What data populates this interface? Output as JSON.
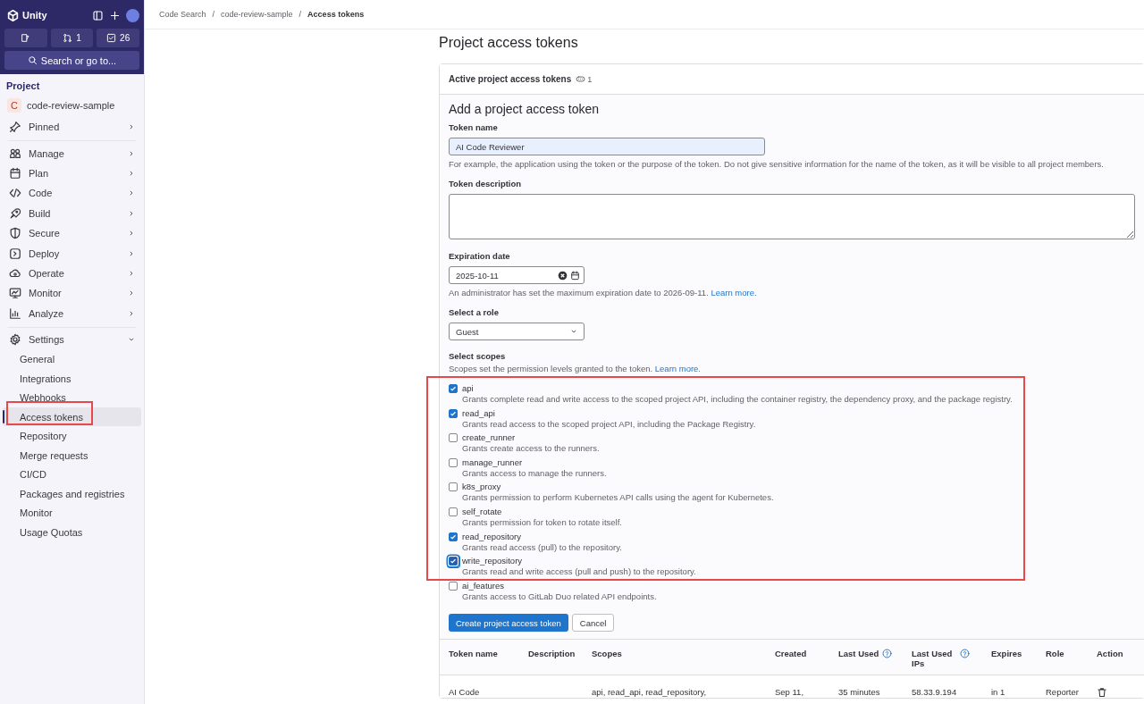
{
  "sidebar": {
    "brand": "Unity",
    "counters": [
      {
        "count": "1"
      },
      {
        "count": "26"
      }
    ],
    "search": "Search or go to...",
    "section": "Project",
    "project": {
      "initial": "C",
      "name": "code-review-sample"
    },
    "groups": [
      [
        {
          "label": "Pinned",
          "expanded": false
        }
      ],
      [
        {
          "label": "Manage",
          "expanded": false
        },
        {
          "label": "Plan",
          "expanded": false
        },
        {
          "label": "Code",
          "expanded": false
        },
        {
          "label": "Build",
          "expanded": false
        },
        {
          "label": "Secure",
          "expanded": false
        },
        {
          "label": "Deploy",
          "expanded": false
        },
        {
          "label": "Operate",
          "expanded": false
        },
        {
          "label": "Monitor",
          "expanded": false
        },
        {
          "label": "Analyze",
          "expanded": false
        }
      ],
      [
        {
          "label": "Settings",
          "expanded": true,
          "children": [
            {
              "label": "General",
              "selected": false
            },
            {
              "label": "Integrations",
              "selected": false
            },
            {
              "label": "Webhooks",
              "selected": false
            },
            {
              "label": "Access tokens",
              "selected": true
            },
            {
              "label": "Repository",
              "selected": false
            },
            {
              "label": "Merge requests",
              "selected": false
            },
            {
              "label": "CI/CD",
              "selected": false
            },
            {
              "label": "Packages and registries",
              "selected": false
            },
            {
              "label": "Monitor",
              "selected": false
            },
            {
              "label": "Usage Quotas",
              "selected": false
            }
          ]
        }
      ]
    ]
  },
  "breadcrumbs": [
    {
      "label": "Code Search"
    },
    {
      "separator": "/",
      "label": "code-review-sample"
    },
    {
      "separator": "/",
      "label": "Access tokens"
    }
  ],
  "title": "Project access tokens",
  "card": {
    "header": "Active project access tokens",
    "count": "1"
  },
  "form": {
    "title": "Add a project access token",
    "token_name": {
      "label": "Token name",
      "value": "AI Code Reviewer",
      "help": "For example, the application using the token or the purpose of the token. Do not give sensitive information for the name of the token, as it will be visible to all project members."
    },
    "token_description": {
      "label": "Token description"
    },
    "expiration": {
      "label": "Expiration date",
      "value": "2025-10-11",
      "help": "An administrator has set the maximum expiration date to 2026-09-11.",
      "link": "Learn more."
    },
    "role": {
      "label": "Select a role",
      "value": "Guest"
    },
    "scopes_label": "Select scopes",
    "scopes_help": "Scopes set the permission levels granted to the token.",
    "scopes_link": "Learn more.",
    "scopes": [
      {
        "name": "api",
        "description": "Grants complete read and write access to the scoped project API, including the container registry, the dependency proxy, and the package registry.",
        "checked": true,
        "focused": false
      },
      {
        "name": "read_api",
        "description": "Grants read access to the scoped project API, including the Package Registry.",
        "checked": true,
        "focused": false
      },
      {
        "name": "create_runner",
        "description": "Grants create access to the runners.",
        "checked": false,
        "focused": false
      },
      {
        "name": "manage_runner",
        "description": "Grants access to manage the runners.",
        "checked": false,
        "focused": false
      },
      {
        "name": "k8s_proxy",
        "description": "Grants permission to perform Kubernetes API calls using the agent for Kubernetes.",
        "checked": false,
        "focused": false
      },
      {
        "name": "self_rotate",
        "description": "Grants permission for token to rotate itself.",
        "checked": false,
        "focused": false
      },
      {
        "name": "read_repository",
        "description": "Grants read access (pull) to the repository.",
        "checked": true,
        "focused": false
      },
      {
        "name": "write_repository",
        "description": "Grants read and write access (pull and push) to the repository.",
        "checked": true,
        "focused": true
      },
      {
        "name": "ai_features",
        "description": "Grants access to GitLab Duo related API endpoints.",
        "checked": false,
        "focused": false
      }
    ],
    "buttons": [
      "Create project access token",
      "Cancel"
    ]
  },
  "table": {
    "columns": [
      {
        "label": "Token name",
        "help": false
      },
      {
        "label": "Description",
        "help": false
      },
      {
        "label": "Scopes",
        "help": false
      },
      {
        "label": "Created",
        "help": false
      },
      {
        "label": "Last Used",
        "help": true
      },
      {
        "label": "Last Used IPs",
        "help": true
      },
      {
        "label": "Expires",
        "help": false
      },
      {
        "label": "Role",
        "help": false
      },
      {
        "label": "Action",
        "help": false
      }
    ],
    "rows": [
      {
        "token_name": "AI Code",
        "scopes": "api, read_api, read_repository,",
        "created": "Sep 11,",
        "last_used": "35 minutes",
        "last_used_ips": "58.33.9.194",
        "expires": "in 1",
        "role": "Reporter"
      }
    ]
  }
}
